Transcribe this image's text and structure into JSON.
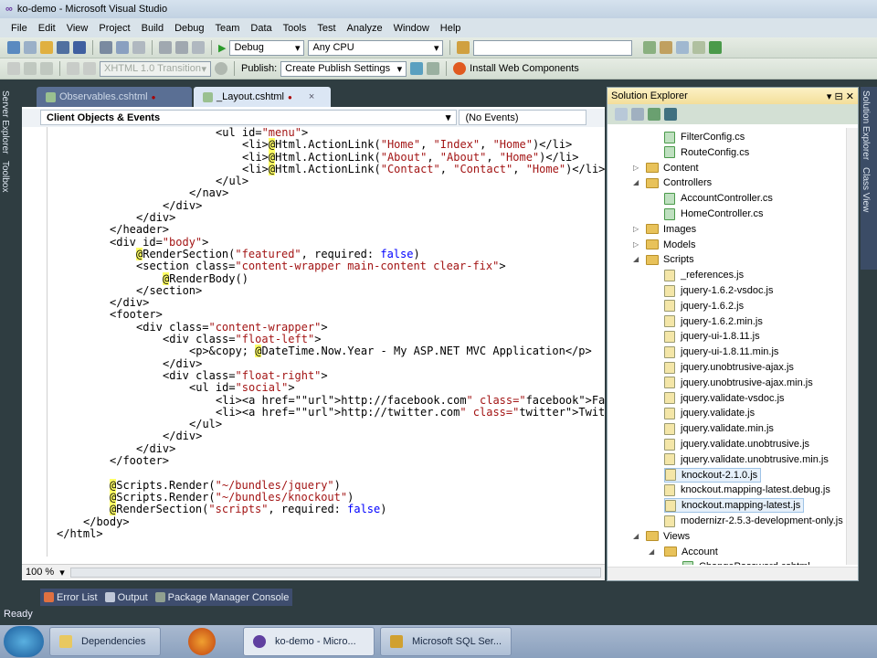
{
  "window": {
    "title": "ko-demo - Microsoft Visual Studio"
  },
  "menu": [
    "File",
    "Edit",
    "View",
    "Project",
    "Build",
    "Debug",
    "Team",
    "Data",
    "Tools",
    "Test",
    "Analyze",
    "Window",
    "Help"
  ],
  "toolbar": {
    "config": "Debug",
    "platform": "Any CPU",
    "doctype": "XHTML 1.0 Transition",
    "publish_label": "Publish:",
    "publish_value": "Create Publish Settings",
    "install_label": "Install Web Components"
  },
  "left_tabs": [
    "Server Explorer",
    "Toolbox"
  ],
  "right_tabs": [
    "Solution Explorer",
    "Class View"
  ],
  "doc_tabs": [
    {
      "label": "Observables.cshtml",
      "modified": "●"
    },
    {
      "label": "_Layout.cshtml",
      "modified": "●",
      "close": "×"
    }
  ],
  "editor": {
    "nav_left": "Client Objects & Events",
    "nav_right": "(No Events)",
    "zoom": "100 %",
    "lines": [
      {
        "i": 6,
        "t": "<ul id=\"menu\">"
      },
      {
        "i": 7,
        "t": "<li>@Html.ActionLink(\"Home\", \"Index\", \"Home\")</li>"
      },
      {
        "i": 7,
        "t": "<li>@Html.ActionLink(\"About\", \"About\", \"Home\")</li>"
      },
      {
        "i": 7,
        "t": "<li>@Html.ActionLink(\"Contact\", \"Contact\", \"Home\")</li>"
      },
      {
        "i": 6,
        "t": "</ul>"
      },
      {
        "i": 5,
        "t": "</nav>"
      },
      {
        "i": 4,
        "t": "</div>"
      },
      {
        "i": 3,
        "t": "</div>"
      },
      {
        "i": 2,
        "t": "</header>"
      },
      {
        "i": 2,
        "t": "<div id=\"body\">"
      },
      {
        "i": 3,
        "t": "@RenderSection(\"featured\", required: false)"
      },
      {
        "i": 3,
        "t": "<section class=\"content-wrapper main-content clear-fix\">"
      },
      {
        "i": 4,
        "t": "@RenderBody()"
      },
      {
        "i": 3,
        "t": "</section>"
      },
      {
        "i": 2,
        "t": "</div>"
      },
      {
        "i": 2,
        "t": "<footer>"
      },
      {
        "i": 3,
        "t": "<div class=\"content-wrapper\">"
      },
      {
        "i": 4,
        "t": "<div class=\"float-left\">"
      },
      {
        "i": 5,
        "t": "<p>&copy; @DateTime.Now.Year - My ASP.NET MVC Application</p>"
      },
      {
        "i": 4,
        "t": "</div>"
      },
      {
        "i": 4,
        "t": "<div class=\"float-right\">"
      },
      {
        "i": 5,
        "t": "<ul id=\"social\">"
      },
      {
        "i": 6,
        "t": "<li><a href=\"http://facebook.com\" class=\"facebook\">Facebook</a></li>"
      },
      {
        "i": 6,
        "t": "<li><a href=\"http://twitter.com\" class=\"twitter\">Twitter</a></li>"
      },
      {
        "i": 5,
        "t": "</ul>"
      },
      {
        "i": 4,
        "t": "</div>"
      },
      {
        "i": 3,
        "t": "</div>"
      },
      {
        "i": 2,
        "t": "</footer>"
      },
      {
        "i": 0,
        "t": ""
      },
      {
        "i": 2,
        "t": "@Scripts.Render(\"~/bundles/jquery\")"
      },
      {
        "i": 2,
        "t": "@Scripts.Render(\"~/bundles/knockout\")"
      },
      {
        "i": 2,
        "t": "@RenderSection(\"scripts\", required: false)"
      },
      {
        "i": 1,
        "t": "</body>"
      },
      {
        "i": 0,
        "t": "</html>"
      }
    ]
  },
  "solution_explorer": {
    "title": "Solution Explorer",
    "items": [
      {
        "label": "FilterConfig.cs",
        "lvl": 2,
        "kind": "cs"
      },
      {
        "label": "RouteConfig.cs",
        "lvl": 2,
        "kind": "cs"
      },
      {
        "label": "Content",
        "lvl": 1,
        "kind": "folder",
        "state": "collapsed"
      },
      {
        "label": "Controllers",
        "lvl": 1,
        "kind": "folder",
        "state": "expanded"
      },
      {
        "label": "AccountController.cs",
        "lvl": 2,
        "kind": "cs"
      },
      {
        "label": "HomeController.cs",
        "lvl": 2,
        "kind": "cs"
      },
      {
        "label": "Images",
        "lvl": 1,
        "kind": "folder",
        "state": "collapsed"
      },
      {
        "label": "Models",
        "lvl": 1,
        "kind": "folder",
        "state": "collapsed"
      },
      {
        "label": "Scripts",
        "lvl": 1,
        "kind": "folder",
        "state": "expanded"
      },
      {
        "label": "_references.js",
        "lvl": 2,
        "kind": "js"
      },
      {
        "label": "jquery-1.6.2-vsdoc.js",
        "lvl": 2,
        "kind": "js"
      },
      {
        "label": "jquery-1.6.2.js",
        "lvl": 2,
        "kind": "js"
      },
      {
        "label": "jquery-1.6.2.min.js",
        "lvl": 2,
        "kind": "js"
      },
      {
        "label": "jquery-ui-1.8.11.js",
        "lvl": 2,
        "kind": "js"
      },
      {
        "label": "jquery-ui-1.8.11.min.js",
        "lvl": 2,
        "kind": "js"
      },
      {
        "label": "jquery.unobtrusive-ajax.js",
        "lvl": 2,
        "kind": "js"
      },
      {
        "label": "jquery.unobtrusive-ajax.min.js",
        "lvl": 2,
        "kind": "js"
      },
      {
        "label": "jquery.validate-vsdoc.js",
        "lvl": 2,
        "kind": "js"
      },
      {
        "label": "jquery.validate.js",
        "lvl": 2,
        "kind": "js"
      },
      {
        "label": "jquery.validate.min.js",
        "lvl": 2,
        "kind": "js"
      },
      {
        "label": "jquery.validate.unobtrusive.js",
        "lvl": 2,
        "kind": "js"
      },
      {
        "label": "jquery.validate.unobtrusive.min.js",
        "lvl": 2,
        "kind": "js"
      },
      {
        "label": "knockout-2.1.0.js",
        "lvl": 2,
        "kind": "js",
        "selected": true
      },
      {
        "label": "knockout.mapping-latest.debug.js",
        "lvl": 2,
        "kind": "js"
      },
      {
        "label": "knockout.mapping-latest.js",
        "lvl": 2,
        "kind": "js",
        "selected": true
      },
      {
        "label": "modernizr-2.5.3-development-only.js",
        "lvl": 2,
        "kind": "js"
      },
      {
        "label": "Views",
        "lvl": 1,
        "kind": "folder",
        "state": "expanded"
      },
      {
        "label": "Account",
        "lvl": 2,
        "kind": "folder",
        "state": "expanded"
      },
      {
        "label": "ChangePassword.cshtml",
        "lvl": 3,
        "kind": "cs"
      }
    ]
  },
  "bottom_tabs": [
    "Error List",
    "Output",
    "Package Manager Console"
  ],
  "status": "Ready",
  "taskbar": [
    "Dependencies",
    "ko-demo - Micro...",
    "Microsoft SQL Ser..."
  ]
}
